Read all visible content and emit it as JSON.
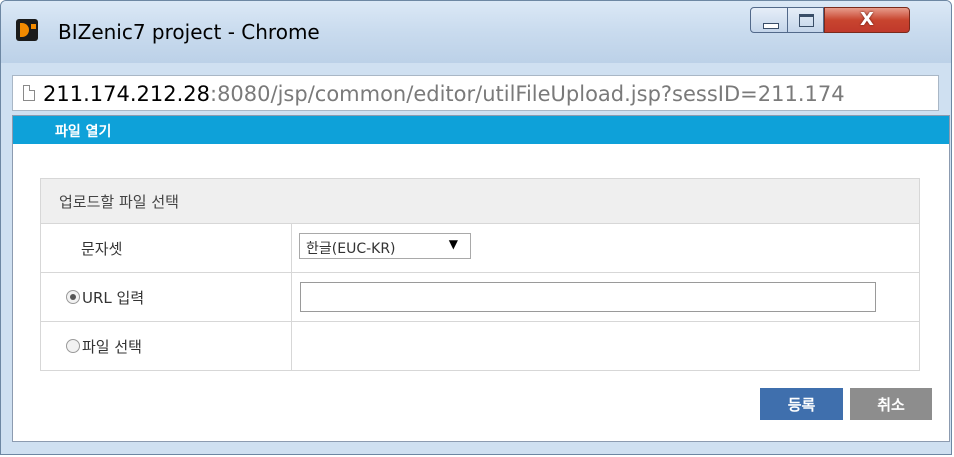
{
  "window": {
    "title": "BIZenic7 project - Chrome",
    "controls": {
      "minimize": "minimize",
      "maximize": "maximize",
      "close": "X"
    }
  },
  "address_bar": {
    "url_host": "211.174.212.28",
    "url_rest": ":8080/jsp/common/editor/utilFileUpload.jsp?sessID=211.174"
  },
  "dialog": {
    "title": "파일 열기",
    "section_header": "업로드할 파일 선택",
    "charset": {
      "label": "문자셋",
      "selected": "한글(EUC-KR)"
    },
    "url_option": {
      "label": "URL 입력",
      "checked": true,
      "value": ""
    },
    "file_option": {
      "label": "파일 선택",
      "checked": false
    },
    "buttons": {
      "ok": "등록",
      "cancel": "취소"
    }
  },
  "icons": {
    "app": "bizenic-app-icon",
    "page": "page-document-icon",
    "dropdown": "caret-down-icon",
    "radio_on": "radio-selected-icon",
    "radio_off": "radio-unselected-icon"
  },
  "colors": {
    "header": "#0ea1d9",
    "ok_button": "#3f6fad",
    "cancel_button": "#8d8d8d",
    "close_button": "#c8452f"
  }
}
